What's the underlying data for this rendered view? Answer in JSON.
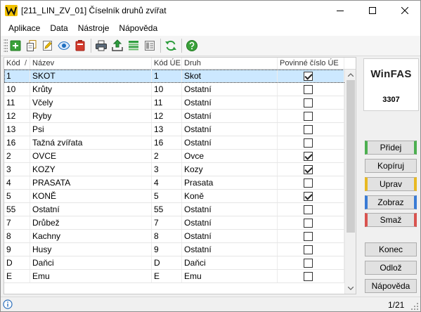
{
  "window": {
    "title": "[211_LIN_ZV_01] Číselník druhů zvířat",
    "app_icon": "winfas-app-icon",
    "controls": [
      "minimize-icon",
      "maximize-icon",
      "close-icon"
    ]
  },
  "menu": {
    "items": [
      {
        "label": "Aplikace"
      },
      {
        "label": "Data"
      },
      {
        "label": "Nástroje"
      },
      {
        "label": "Nápověda"
      }
    ]
  },
  "toolbar": {
    "icons": [
      "add-icon",
      "copy-icon",
      "edit-icon",
      "view-icon",
      "delete-icon",
      "print-icon",
      "export-icon",
      "list-icon",
      "form-icon",
      "refresh-icon",
      "help-icon"
    ]
  },
  "table": {
    "columns": {
      "code": "Kód",
      "sort_indicator": "/",
      "name": "Název",
      "code_ue": "Kód ÚE",
      "kind": "Druh",
      "mandatory": "Povinné číslo ÚE"
    },
    "rows": [
      {
        "code": "1",
        "name": "SKOT",
        "code_ue": "1",
        "kind": "Skot",
        "mandatory": true,
        "selected": true
      },
      {
        "code": "10",
        "name": "Krůty",
        "code_ue": "10",
        "kind": "Ostatní",
        "mandatory": false
      },
      {
        "code": "11",
        "name": "Včely",
        "code_ue": "11",
        "kind": "Ostatní",
        "mandatory": false
      },
      {
        "code": "12",
        "name": "Ryby",
        "code_ue": "12",
        "kind": "Ostatní",
        "mandatory": false
      },
      {
        "code": "13",
        "name": "Psi",
        "code_ue": "13",
        "kind": "Ostatní",
        "mandatory": false
      },
      {
        "code": "16",
        "name": "Tažná zvířata",
        "code_ue": "16",
        "kind": "Ostatní",
        "mandatory": false
      },
      {
        "code": "2",
        "name": "OVCE",
        "code_ue": "2",
        "kind": "Ovce",
        "mandatory": true
      },
      {
        "code": "3",
        "name": "KOZY",
        "code_ue": "3",
        "kind": "Kozy",
        "mandatory": true
      },
      {
        "code": "4",
        "name": "PRASATA",
        "code_ue": "4",
        "kind": "Prasata",
        "mandatory": false
      },
      {
        "code": "5",
        "name": "KONĚ",
        "code_ue": "5",
        "kind": "Koně",
        "mandatory": true
      },
      {
        "code": "55",
        "name": "Ostatní",
        "code_ue": "55",
        "kind": "Ostatní",
        "mandatory": false
      },
      {
        "code": "7",
        "name": "Drůbež",
        "code_ue": "7",
        "kind": "Ostatní",
        "mandatory": false
      },
      {
        "code": "8",
        "name": "Kachny",
        "code_ue": "8",
        "kind": "Ostatní",
        "mandatory": false
      },
      {
        "code": "9",
        "name": "Husy",
        "code_ue": "9",
        "kind": "Ostatní",
        "mandatory": false
      },
      {
        "code": "D",
        "name": "Daňci",
        "code_ue": "D",
        "kind": "Daňci",
        "mandatory": false
      },
      {
        "code": "E",
        "name": "Emu",
        "code_ue": "E",
        "kind": "Emu",
        "mandatory": false
      }
    ]
  },
  "side": {
    "logo": "WinFAS",
    "number": "3307",
    "buttons": [
      {
        "label": "Přidej",
        "accent": "#4caf50"
      },
      {
        "label": "Kopíruj"
      },
      {
        "label": "Uprav",
        "accent": "#e8b923"
      },
      {
        "label": "Zobraz",
        "accent": "#3a7bd5"
      },
      {
        "label": "Smaž",
        "accent": "#d9534f"
      },
      {
        "label": "Konec"
      },
      {
        "label": "Odlož"
      },
      {
        "label": "Nápověda"
      }
    ]
  },
  "status": {
    "info_icon": "info-icon",
    "position": "1/21"
  },
  "colors": {
    "selection": "#cce8ff",
    "background": "#f0f0f0"
  }
}
